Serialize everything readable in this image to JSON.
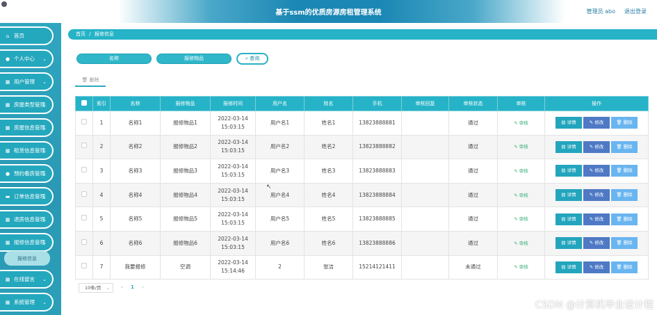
{
  "header": {
    "title": "基于ssm的优质房源房租管理系统",
    "user": "管理员 abo",
    "logout": "退出登录"
  },
  "sidebar": {
    "items": [
      {
        "label": "首页",
        "icon": "home-icon",
        "glyph": "⌂",
        "chevron": false
      },
      {
        "label": "个人中心",
        "icon": "user-icon",
        "glyph": "●",
        "chevron": true
      },
      {
        "label": "用户管理",
        "icon": "grid-icon",
        "glyph": "▦",
        "chevron": true
      },
      {
        "label": "房屋类型管理",
        "icon": "grid-icon",
        "glyph": "▦",
        "chevron": true
      },
      {
        "label": "房屋信息管理",
        "icon": "grid-icon",
        "glyph": "▦",
        "chevron": true
      },
      {
        "label": "租赁信息管理",
        "icon": "grid-icon",
        "glyph": "▦",
        "chevron": true
      },
      {
        "label": "预约看房管理",
        "icon": "user-icon",
        "glyph": "●",
        "chevron": true
      },
      {
        "label": "订单信息管理",
        "icon": "chat-icon",
        "glyph": "▬",
        "chevron": true
      },
      {
        "label": "退房信息管理",
        "icon": "grid-icon",
        "glyph": "▦",
        "chevron": true
      },
      {
        "label": "报修信息管理",
        "icon": "grid-icon",
        "glyph": "▦",
        "chevron": true
      },
      {
        "label": "在线留言",
        "icon": "grid-icon",
        "glyph": "▦",
        "chevron": true
      },
      {
        "label": "系统管理",
        "icon": "grid-icon",
        "glyph": "▦",
        "chevron": true
      }
    ],
    "submenu": {
      "label": "报修信息"
    }
  },
  "breadcrumb": {
    "home": "首页",
    "separator": "/",
    "current": "报修信息"
  },
  "search": {
    "name_placeholder": "名称",
    "item_placeholder": "报修物品",
    "query_label": "查询"
  },
  "actions": {
    "delete_label": "删除"
  },
  "table": {
    "headers": [
      "索引",
      "名称",
      "报修物品",
      "报修时间",
      "用户名",
      "姓名",
      "手机",
      "审核回复",
      "审核状态",
      "审核",
      "操作"
    ],
    "audit_label": "审核",
    "detail_label": "详情",
    "edit_label": "修改",
    "delete_label": "删除",
    "rows": [
      {
        "index": "1",
        "name": "名称1",
        "item": "报修物品1",
        "time": "2022-03-14 15:03:15",
        "username": "用户名1",
        "realname": "姓名1",
        "phone": "13823888881",
        "reply": "",
        "status": "通过"
      },
      {
        "index": "2",
        "name": "名称2",
        "item": "报修物品2",
        "time": "2022-03-14 15:03:15",
        "username": "用户名2",
        "realname": "姓名2",
        "phone": "13823888882",
        "reply": "",
        "status": "通过"
      },
      {
        "index": "3",
        "name": "名称3",
        "item": "报修物品3",
        "time": "2022-03-14 15:03:15",
        "username": "用户名3",
        "realname": "姓名3",
        "phone": "13823888883",
        "reply": "",
        "status": "通过"
      },
      {
        "index": "4",
        "name": "名称4",
        "item": "报修物品4",
        "time": "2022-03-14 15:03:15",
        "username": "用户名4",
        "realname": "姓名4",
        "phone": "13823888884",
        "reply": "",
        "status": "通过"
      },
      {
        "index": "5",
        "name": "名称5",
        "item": "报修物品5",
        "time": "2022-03-14 15:03:15",
        "username": "用户名5",
        "realname": "姓名5",
        "phone": "13823888885",
        "reply": "",
        "status": "通过"
      },
      {
        "index": "6",
        "name": "名称6",
        "item": "报修物品6",
        "time": "2022-03-14 15:03:15",
        "username": "用户名6",
        "realname": "姓名6",
        "phone": "13823888886",
        "reply": "",
        "status": "通过"
      },
      {
        "index": "7",
        "name": "我要报修",
        "item": "空调",
        "time": "2022-03-14 15:14:46",
        "username": "2",
        "realname": "张洁",
        "phone": "15214121411",
        "reply": "",
        "status": "未通过"
      }
    ]
  },
  "pagination": {
    "page_size": "10条/页",
    "prev": "‹",
    "current": "1",
    "next": "›"
  },
  "watermark": "CSDN @计算机毕业设计程",
  "colors": {
    "accent": "#26b3c7",
    "edit": "#4f79c5",
    "delete": "#69b5f0",
    "detail": "#23a5bd"
  }
}
